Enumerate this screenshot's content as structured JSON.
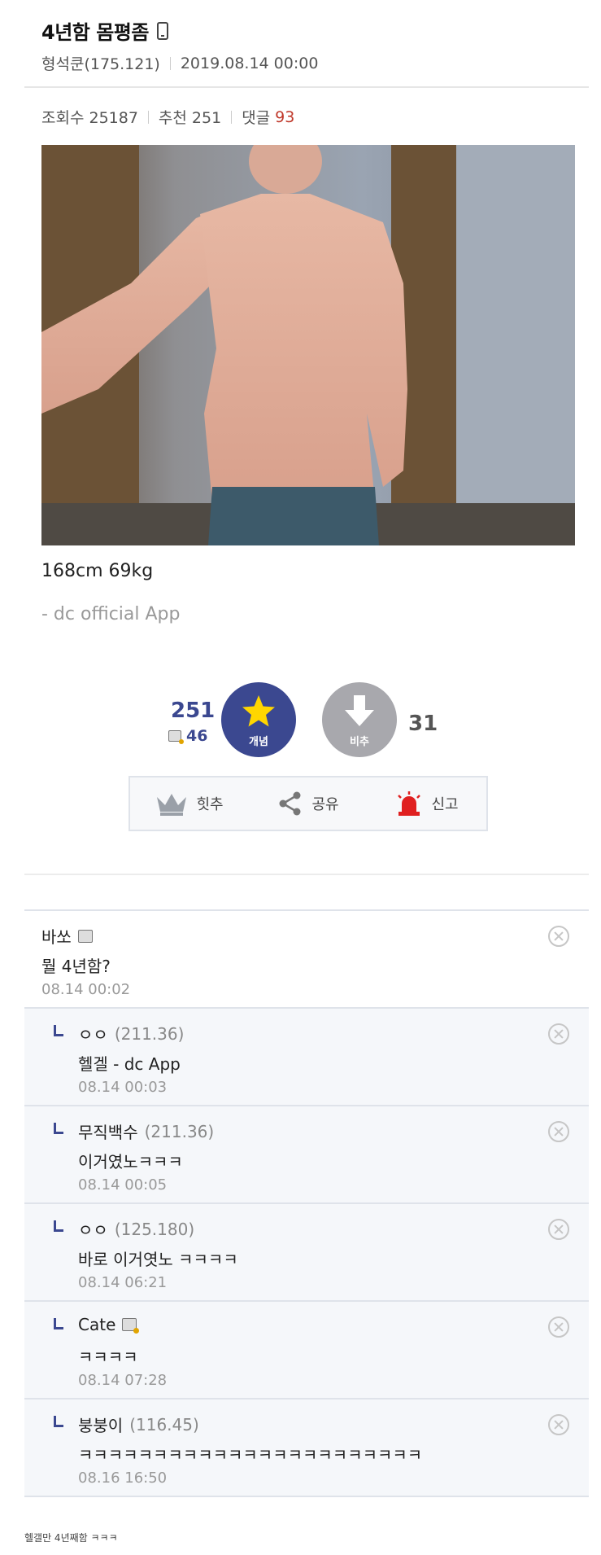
{
  "post": {
    "title": "4년함 몸평좀",
    "author": "형석쿤(175.121)",
    "datetime": "2019.08.14 00:00",
    "views": "조회수 25187",
    "recommend": "추천 251",
    "comments_label": "댓글",
    "comments_count": "93",
    "body_text": "168cm 69kg",
    "app_signature": "- dc official App"
  },
  "votes": {
    "up_count": "251",
    "up_fixed_count": "46",
    "up_label": "개념",
    "down_label": "비추",
    "down_count": "31"
  },
  "actions": {
    "hit": "힛추",
    "share": "공유",
    "report": "신고"
  },
  "comments": [
    {
      "name": "바쏘",
      "ip": "",
      "text": "뭘 4년함?",
      "date": "08.14 00:02"
    },
    {
      "name": "ㅇㅇ",
      "ip": "(211.36)",
      "text": "헬겔 - dc App",
      "date": "08.14 00:03"
    },
    {
      "name": "무직백수",
      "ip": "(211.36)",
      "text": "이거였노ㅋㅋㅋ",
      "date": "08.14 00:05"
    },
    {
      "name": "ㅇㅇ",
      "ip": "(125.180)",
      "text": "바로 이거엿노 ㅋㅋㅋㅋ",
      "date": "08.14 06:21"
    },
    {
      "name": "Cate",
      "ip": "",
      "text": "ㅋㅋㅋㅋ",
      "date": "08.14 07:28"
    },
    {
      "name": "붕붕이",
      "ip": "(116.45)",
      "text": "ㅋㅋㅋㅋㅋㅋㅋㅋㅋㅋㅋㅋㅋㅋㅋㅋㅋㅋㅋㅋㅋㅋㅋ",
      "date": "08.16 16:50"
    }
  ],
  "caption": "헬갤만 4년째함 ㅋㅋㅋ",
  "colors": {
    "accent": "#3b4890",
    "comment_count": "#c0392b",
    "downvote": "#a8a8ad"
  }
}
